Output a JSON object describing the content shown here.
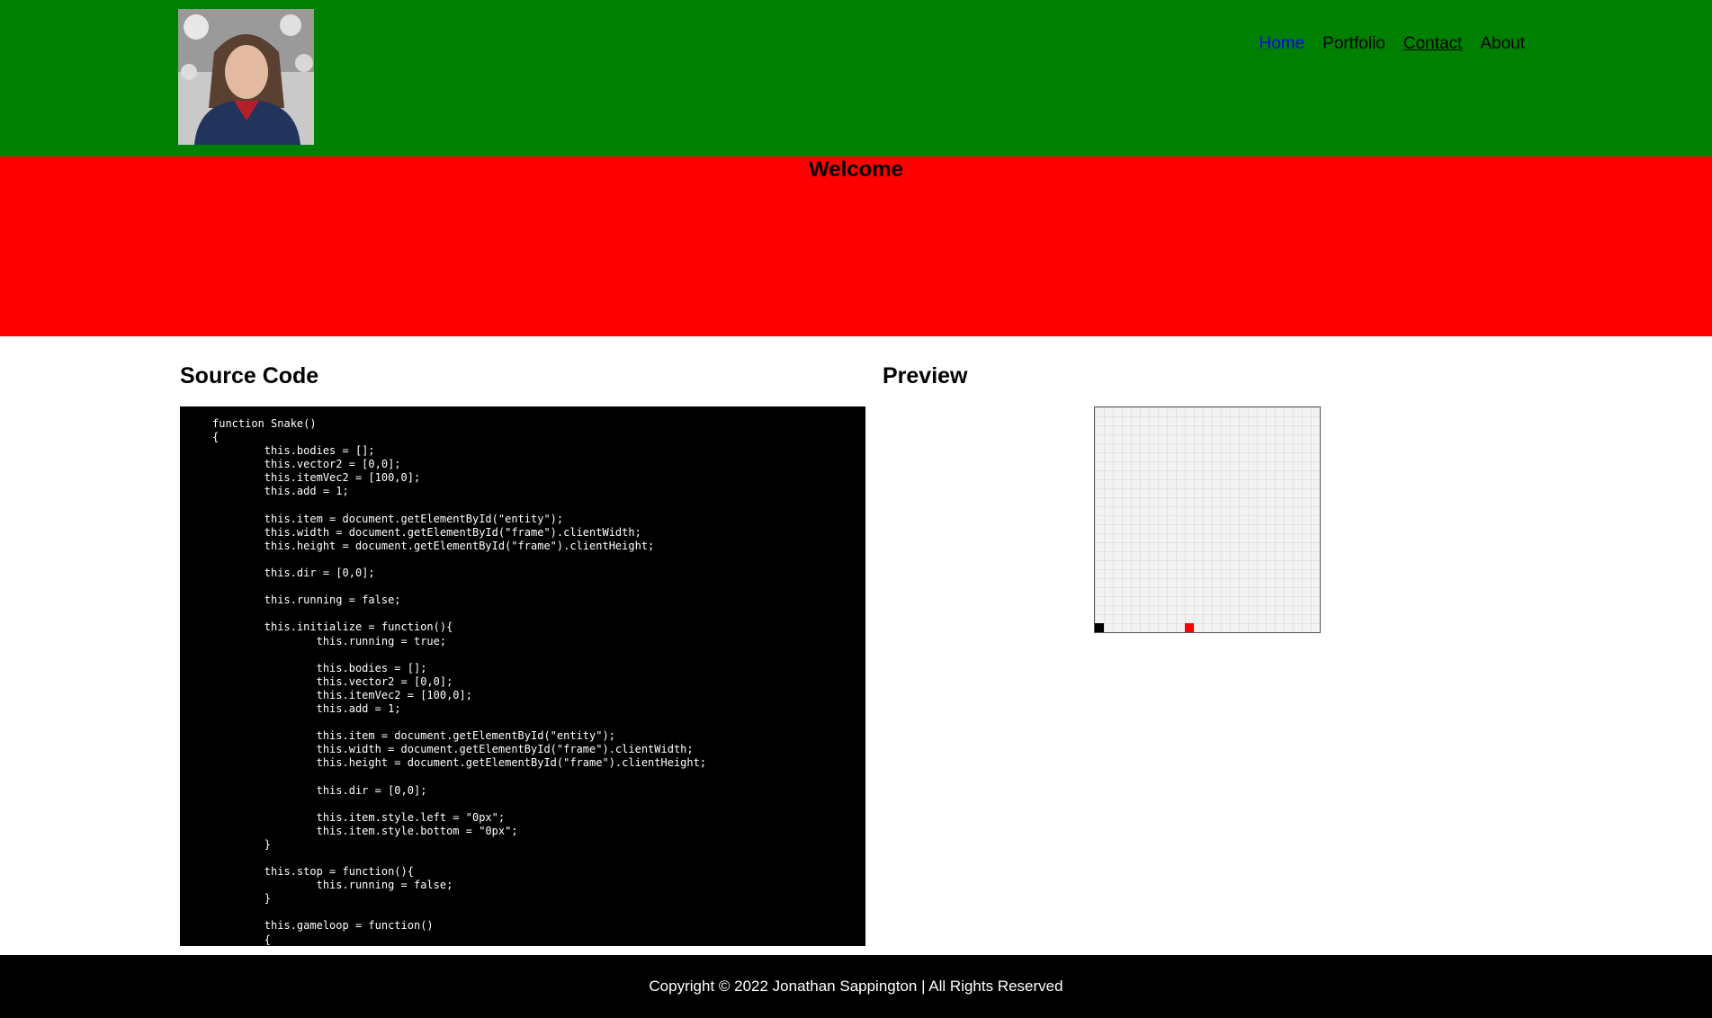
{
  "nav": {
    "items": [
      {
        "label": "Home"
      },
      {
        "label": "Portfolio"
      },
      {
        "label": "Contact"
      },
      {
        "label": "About"
      }
    ]
  },
  "hero": {
    "title": "Welcome"
  },
  "source": {
    "heading": "Source Code",
    "code": "function Snake()\n{\n        this.bodies = [];\n        this.vector2 = [0,0];\n        this.itemVec2 = [100,0];\n        this.add = 1;\n\n        this.item = document.getElementById(\"entity\");\n        this.width = document.getElementById(\"frame\").clientWidth;\n        this.height = document.getElementById(\"frame\").clientHeight;\n\n        this.dir = [0,0];\n\n        this.running = false;\n\n        this.initialize = function(){\n                this.running = true;\n\n                this.bodies = [];\n                this.vector2 = [0,0];\n                this.itemVec2 = [100,0];\n                this.add = 1;\n\n                this.item = document.getElementById(\"entity\");\n                this.width = document.getElementById(\"frame\").clientWidth;\n                this.height = document.getElementById(\"frame\").clientHeight;\n\n                this.dir = [0,0];\n\n                this.item.style.left = \"0px\";\n                this.item.style.bottom = \"0px\";\n        }\n\n        this.stop = function(){\n                this.running = false;\n        }\n\n        this.gameloop = function()\n        {"
  },
  "preview": {
    "heading": "Preview",
    "snake_color": "#000000",
    "food_color": "#ff0000"
  },
  "footer": {
    "text": "Copyright © 2022 Jonathan Sappington | All Rights Reserved"
  },
  "colors": {
    "header_bg": "#008000",
    "hero_bg": "#ff0000",
    "footer_bg": "#000000",
    "nav_active": "#0000ff"
  }
}
